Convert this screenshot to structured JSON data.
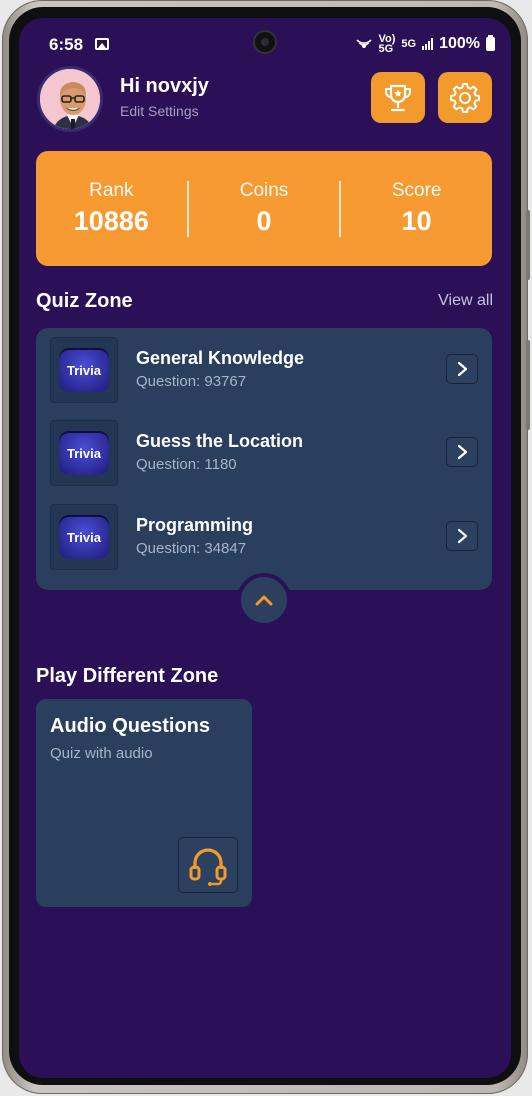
{
  "status_bar": {
    "time": "6:58",
    "battery": "100%",
    "network": "5G"
  },
  "header": {
    "greeting": "Hi novxjy",
    "subtitle": "Edit Settings"
  },
  "stats": [
    {
      "label": "Rank",
      "value": "10886"
    },
    {
      "label": "Coins",
      "value": "0"
    },
    {
      "label": "Score",
      "value": "10"
    }
  ],
  "quiz_zone": {
    "title": "Quiz Zone",
    "view_all": "View all",
    "items": [
      {
        "badge": "Trivia",
        "title": "General Knowledge",
        "subtitle": "Question: 93767"
      },
      {
        "badge": "Trivia",
        "title": "Guess the Location",
        "subtitle": "Question: 1180"
      },
      {
        "badge": "Trivia",
        "title": "Programming",
        "subtitle": "Question: 34847"
      }
    ]
  },
  "play_zone": {
    "title": "Play Different Zone",
    "cards": [
      {
        "title": "Audio Questions",
        "subtitle": "Quiz with audio",
        "icon": "headphones-icon"
      }
    ]
  },
  "colors": {
    "background": "#2b0f57",
    "accent": "#f79a31",
    "card": "#2a3e5e"
  }
}
